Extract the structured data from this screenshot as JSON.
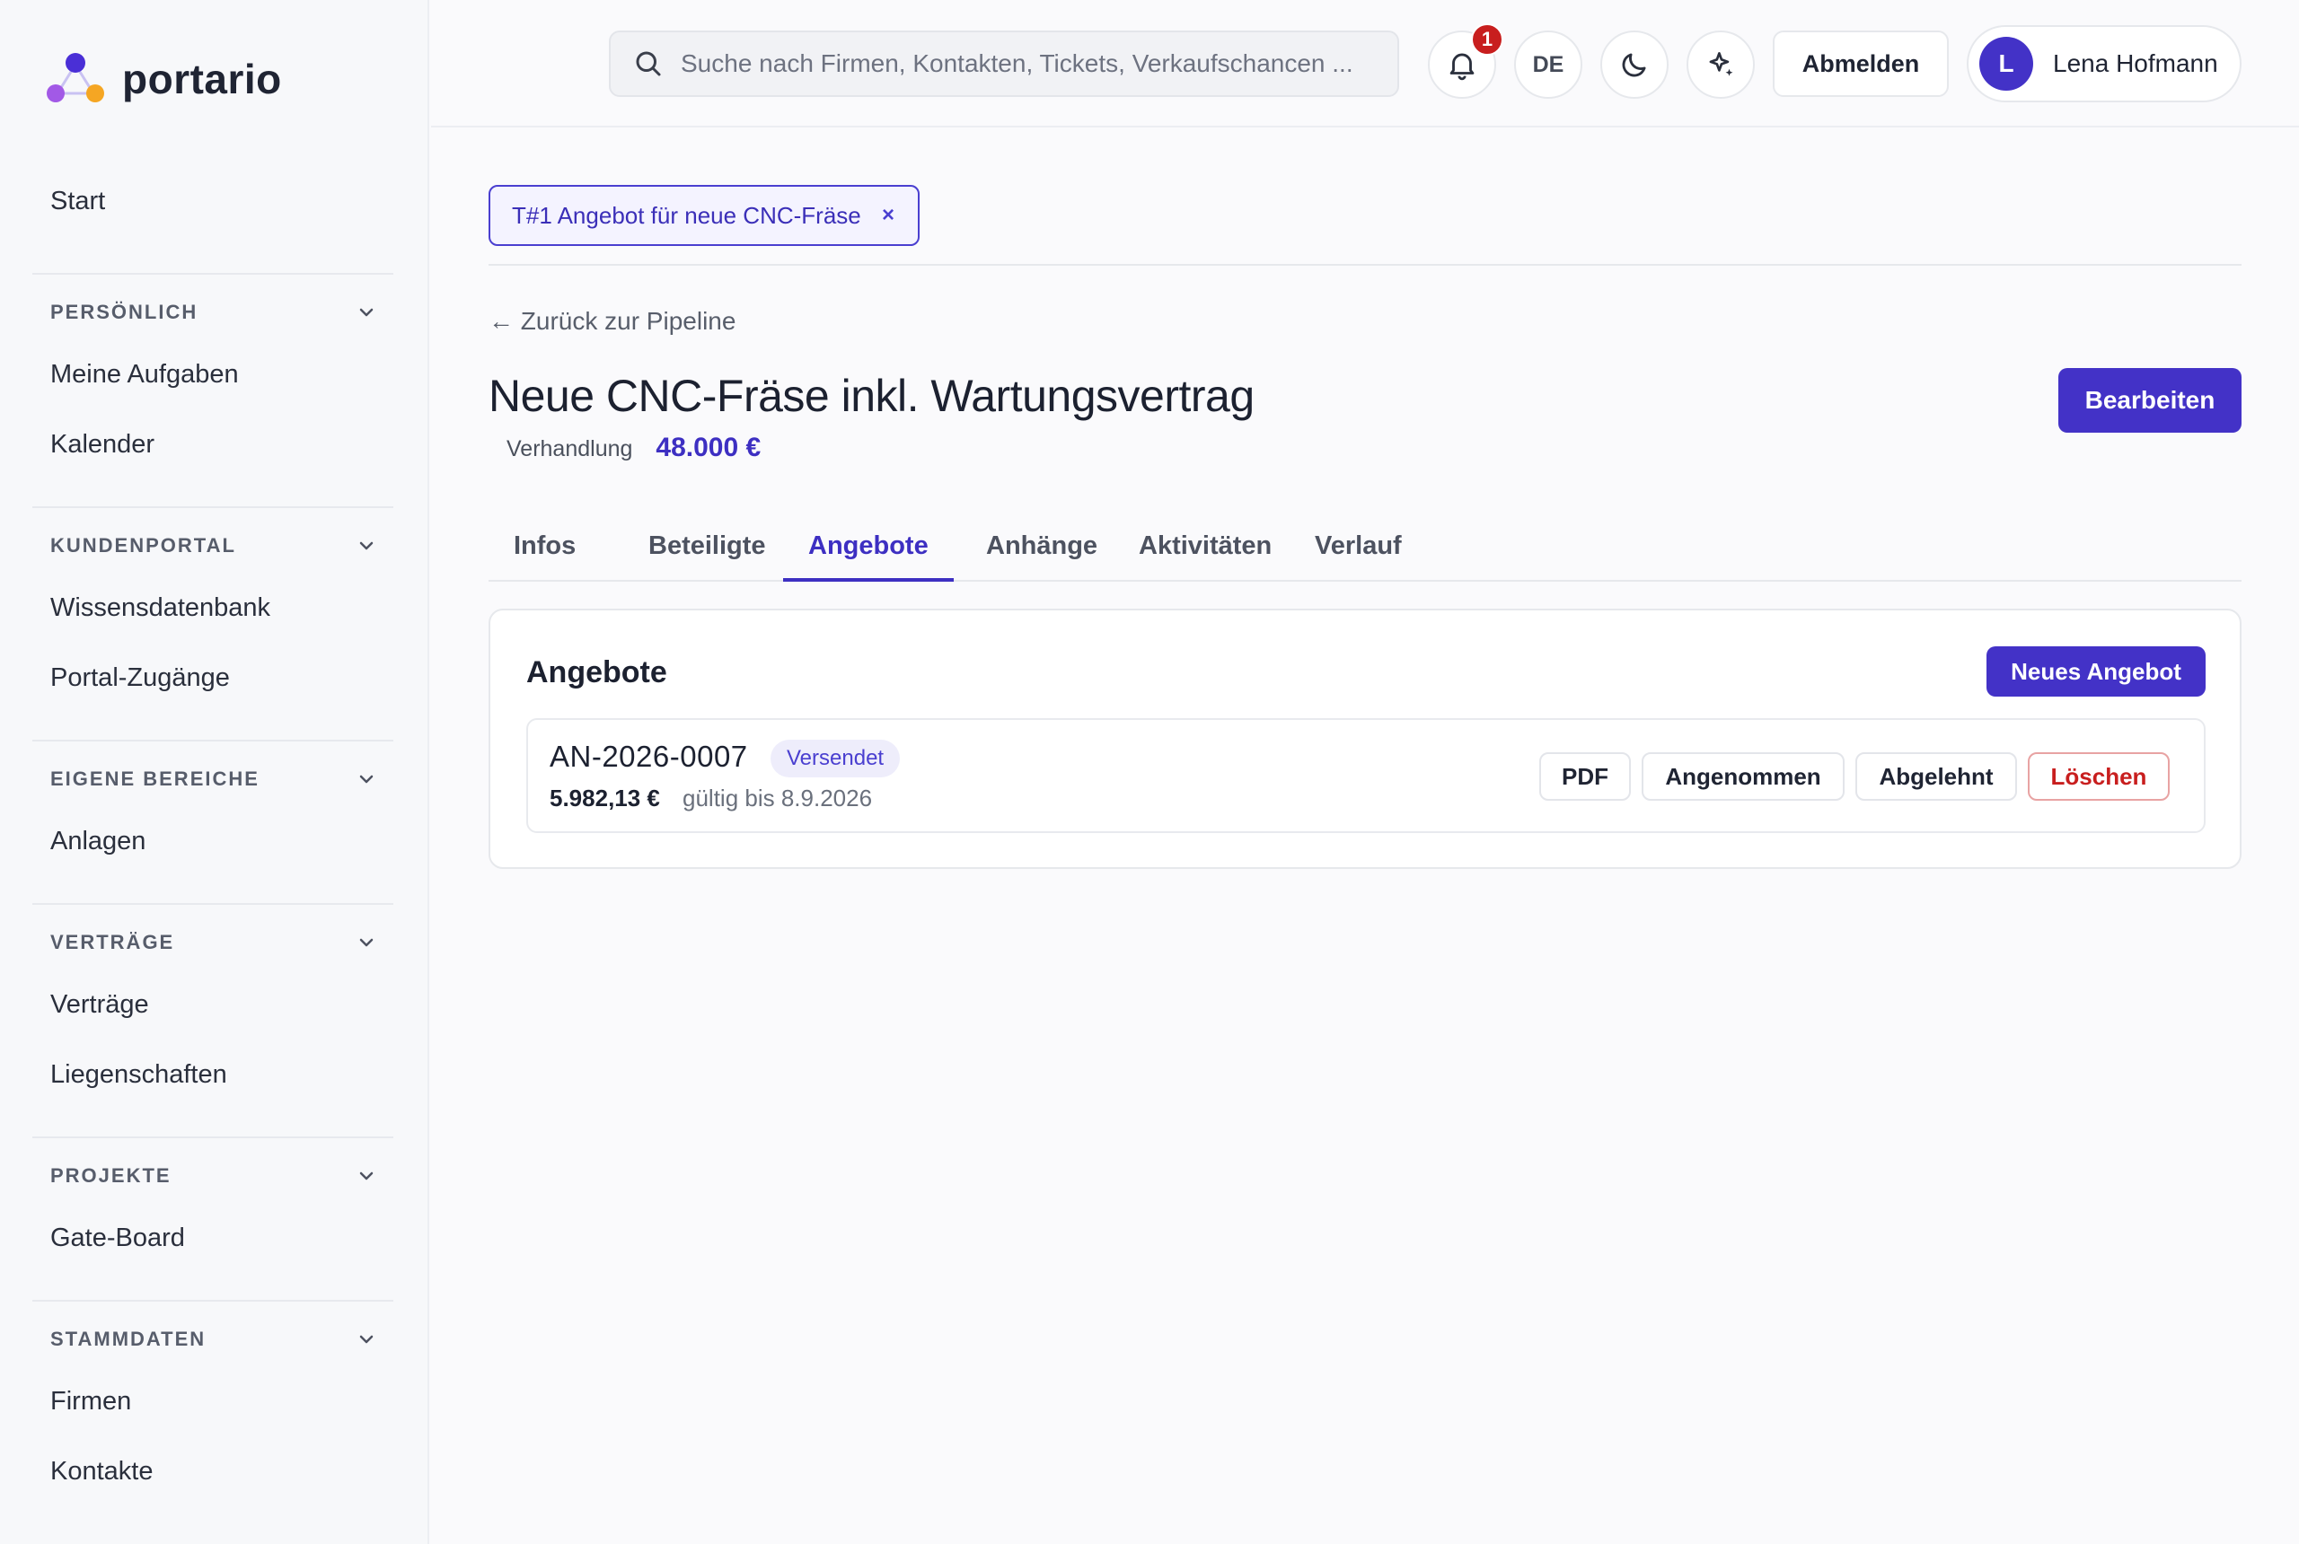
{
  "brand": {
    "name": "portario"
  },
  "sidebar": {
    "start": "Start",
    "sections": [
      {
        "title": "PERSÖNLICH",
        "items": [
          "Meine Aufgaben",
          "Kalender"
        ]
      },
      {
        "title": "KUNDENPORTAL",
        "items": [
          "Wissensdatenbank",
          "Portal-Zugänge"
        ]
      },
      {
        "title": "EIGENE BEREICHE",
        "items": [
          "Anlagen"
        ]
      },
      {
        "title": "VERTRÄGE",
        "items": [
          "Verträge",
          "Liegenschaften"
        ]
      },
      {
        "title": "PROJEKTE",
        "items": [
          "Gate-Board"
        ]
      },
      {
        "title": "STAMMDATEN",
        "items": [
          "Firmen",
          "Kontakte"
        ]
      }
    ]
  },
  "topbar": {
    "search_placeholder": "Suche nach Firmen, Kontakten, Tickets, Verkaufschancen ...",
    "notification_count": "1",
    "language": "DE",
    "logout_label": "Abmelden",
    "user": {
      "initial": "L",
      "name": "Lena Hofmann"
    }
  },
  "ticket_tab": {
    "label": "T#1 Angebot für neue CNC-Fräse",
    "close": "×"
  },
  "deal": {
    "back_label": "← Zurück zur Pipeline",
    "title": "Neue CNC-Fräse inkl. Wartungsvertrag",
    "stage": "Verhandlung",
    "amount": "48.000 €",
    "edit_label": "Bearbeiten"
  },
  "tabs": [
    "Infos",
    "Beteiligte",
    "Angebote",
    "Anhänge",
    "Aktivitäten",
    "Verlauf"
  ],
  "active_tab": "Angebote",
  "offers_card": {
    "title": "Angebote",
    "new_label": "Neues Angebot",
    "offers": [
      {
        "id": "AN-2026-0007",
        "status": "Versendet",
        "price": "5.982,13 €",
        "valid": "gültig bis 8.9.2026",
        "actions": {
          "pdf": "PDF",
          "accept": "Angenommen",
          "reject": "Abgelehnt",
          "delete": "Löschen"
        }
      }
    ]
  },
  "colors": {
    "accent": "#4332c7",
    "danger": "#c81e1e",
    "logo_purple": "#4a2fd6",
    "logo_violet": "#a259e6",
    "logo_orange": "#f5a623"
  }
}
